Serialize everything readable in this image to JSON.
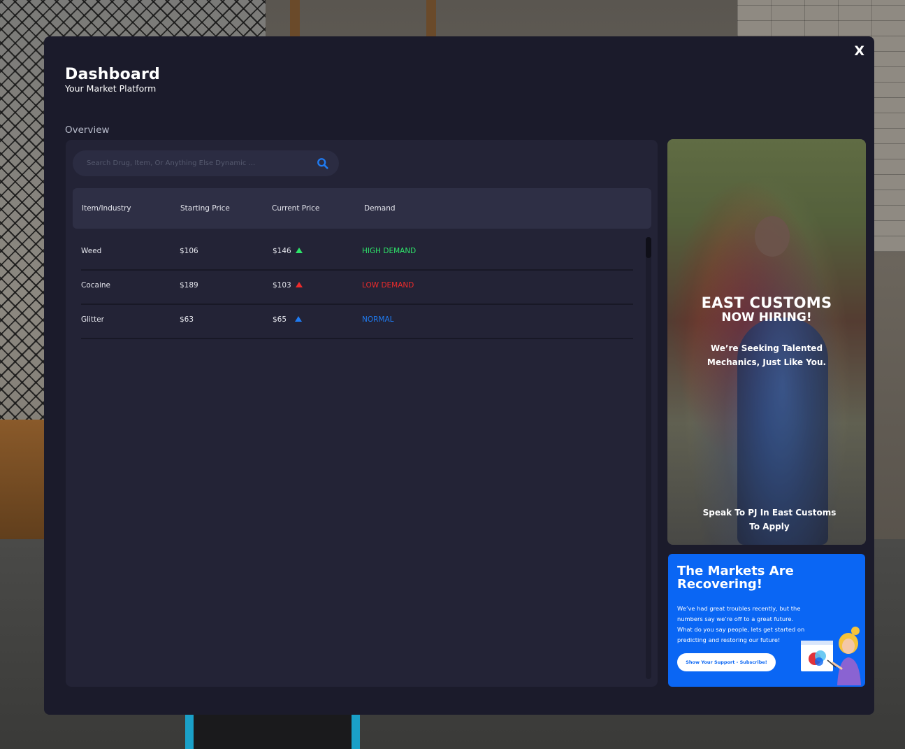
{
  "header": {
    "close_label": "X",
    "title": "Dashboard",
    "subtitle": "Your Market Platform",
    "section": "Overview"
  },
  "search": {
    "placeholder": "Search Drug, Item, Or Anything Else Dynamic ...",
    "icon": "search-icon"
  },
  "table": {
    "columns": [
      "Item/Industry",
      "Starting Price",
      "Current Price",
      "Demand"
    ],
    "rows": [
      {
        "item": "Weed",
        "start": "$106",
        "current": "$146",
        "demand": "HIGH DEMAND",
        "color": "#2ee56a",
        "trend": "up"
      },
      {
        "item": "Cocaine",
        "start": "$189",
        "current": "$103",
        "demand": "LOW DEMAND",
        "color": "#ef2b2b",
        "trend": "up"
      },
      {
        "item": "Glitter",
        "start": "$63",
        "current": "$65",
        "demand": "NORMAL",
        "color": "#1f7bf2",
        "trend": "up"
      }
    ]
  },
  "ad": {
    "heading": "EAST CUSTOMS",
    "subheading": "NOW HIRING!",
    "line1": "We’re Seeking Talented",
    "line2": "Mechanics, Just Like You.",
    "footer1": "Speak To PJ In East Customs",
    "footer2": "To Apply"
  },
  "promo": {
    "title_line1": "The Markets Are",
    "title_line2": "Recovering!",
    "body_lines": [
      "We’ve had great troubles recently, but the",
      "numbers say we’re off to a great future.",
      "What do you say people, lets get started on",
      "predicting and restoring our future!"
    ],
    "button_label": "Show Your Support - Subscribe!"
  },
  "colors": {
    "panel": "#1b1b2b",
    "card": "#232336",
    "accent": "#0a66f4",
    "high": "#2ee56a",
    "low": "#ef2b2b",
    "normal": "#1f7bf2"
  }
}
